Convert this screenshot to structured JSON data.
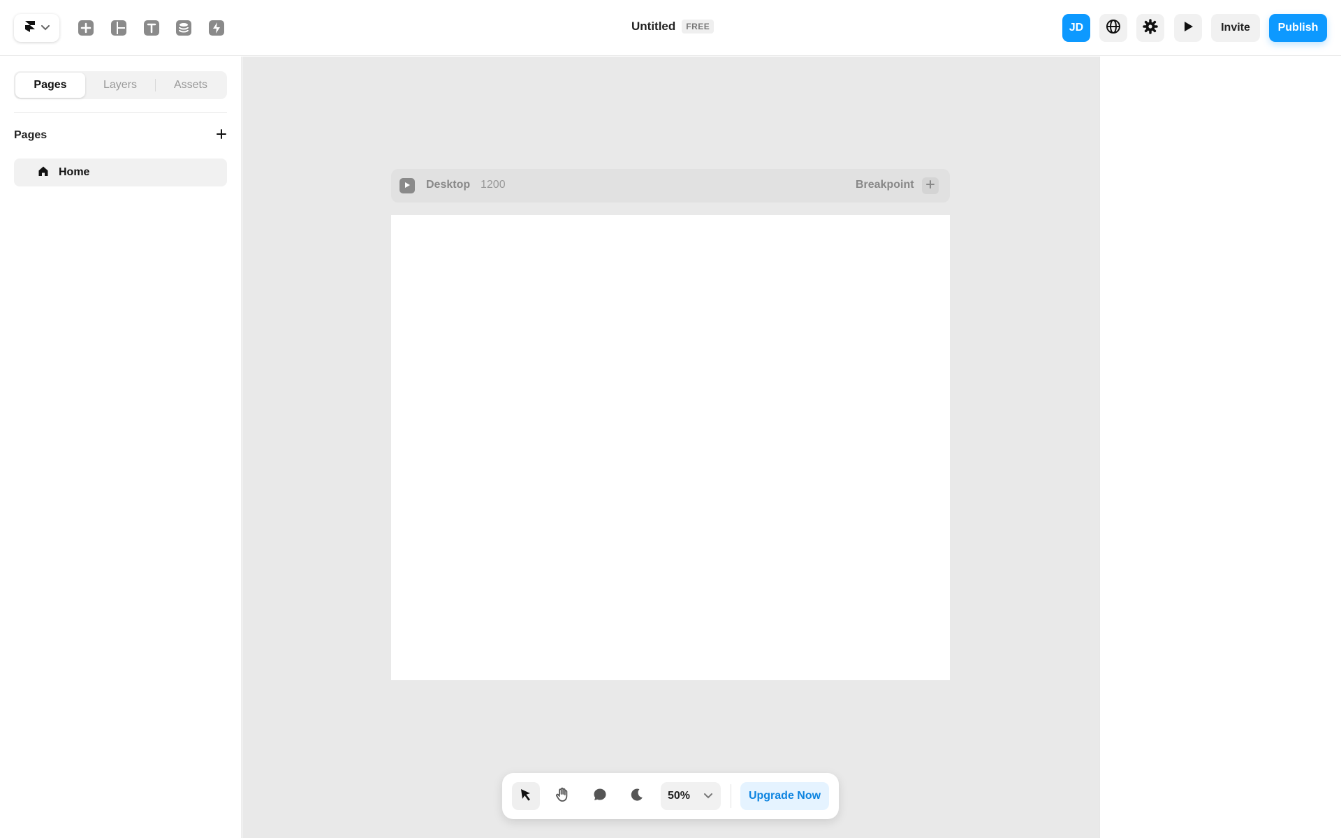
{
  "topbar": {
    "title": "Untitled",
    "plan_badge": "FREE",
    "tools": [
      "insert-icon",
      "layout-icon",
      "text-icon",
      "cms-icon",
      "interactions-icon"
    ],
    "avatar_initials": "JD",
    "invite_label": "Invite",
    "publish_label": "Publish"
  },
  "sidebar": {
    "tabs": [
      {
        "label": "Pages",
        "active": true
      },
      {
        "label": "Layers",
        "active": false
      },
      {
        "label": "Assets",
        "active": false
      }
    ],
    "section_title": "Pages",
    "pages": [
      {
        "label": "Home",
        "icon": "home-icon"
      }
    ]
  },
  "canvas": {
    "breakpoint_name": "Desktop",
    "breakpoint_width": "1200",
    "breakpoint_add_label": "Breakpoint"
  },
  "bottom_toolbar": {
    "tools": [
      "pointer-icon",
      "hand-icon",
      "comment-icon",
      "moon-icon"
    ],
    "zoom": "50%",
    "upgrade_label": "Upgrade Now"
  },
  "colors": {
    "accent": "#0d99ff",
    "canvas_bg": "#e9e9e9",
    "upgrade_bg": "#e5f3ff"
  }
}
